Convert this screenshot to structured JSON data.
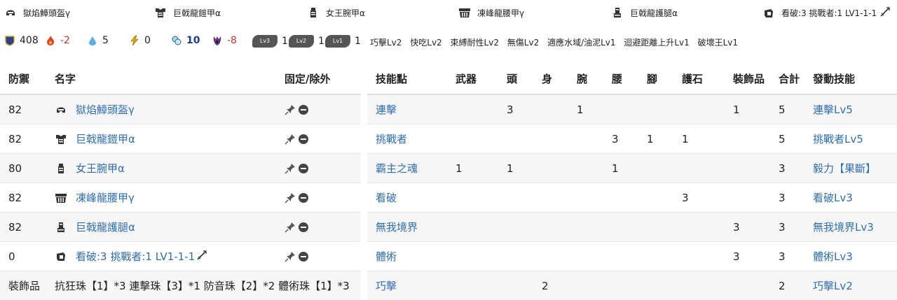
{
  "equipment_bar": [
    {
      "icon": "helm-icon",
      "name": "獄焰鱆頭盔γ"
    },
    {
      "icon": "chest-icon",
      "name": "巨戟龍鎧甲α"
    },
    {
      "icon": "arm-icon",
      "name": "女王腕甲α"
    },
    {
      "icon": "waist-icon",
      "name": "凍峰龍腰甲γ"
    },
    {
      "icon": "leg-icon",
      "name": "巨戟龍護腿α"
    },
    {
      "icon": "charm-icon",
      "name": "看破:3 挑戰者:1 LV1-1-1"
    }
  ],
  "stats": {
    "defense": "408",
    "fire": "-2",
    "water": "5",
    "thunder": "0",
    "ice": "10",
    "dragon": "-8",
    "slot_lv3_label": "Lv3",
    "slot_lv3_count": "1",
    "slot_lv2_label": "Lv2",
    "slot_lv2_count": "1",
    "slot_lv1_label": "Lv1",
    "slot_lv1_count": "1",
    "colors": {
      "fire": "#c0392b",
      "ice": "#1e3a8a",
      "link": "#2f6fb0"
    }
  },
  "skill_summary": [
    "巧擊Lv2",
    "快吃Lv2",
    "束縛耐性Lv2",
    "無傷Lv2",
    "適應水域/油泥Lv1",
    "迴避距離上升Lv1",
    "破壞王Lv1"
  ],
  "armor_table": {
    "headers": {
      "defense": "防禦",
      "name": "名字",
      "fix": "固定/除外"
    },
    "rows": [
      {
        "defense": "82",
        "icon": "helm-icon",
        "name": "獄焰鱆頭盔γ"
      },
      {
        "defense": "82",
        "icon": "chest-icon",
        "name": "巨戟龍鎧甲α"
      },
      {
        "defense": "80",
        "icon": "arm-icon",
        "name": "女王腕甲α"
      },
      {
        "defense": "82",
        "icon": "waist-icon",
        "name": "凍峰龍腰甲γ"
      },
      {
        "defense": "82",
        "icon": "leg-icon",
        "name": "巨戟龍護腿α"
      },
      {
        "defense": "0",
        "icon": "charm-icon",
        "name": "看破:3 挑戰者:1 LV1-1-1"
      }
    ],
    "decorations_label": "裝飾品",
    "decorations_value": "抗狂珠【1】*3 連擊珠【3】*1 防音珠【2】*2 體術珠【1】*3"
  },
  "skill_table": {
    "headers": {
      "skill": "技能點",
      "weapon": "武器",
      "head": "頭",
      "body": "身",
      "arm": "腕",
      "waist": "腰",
      "leg": "腳",
      "charm": "護石",
      "deco": "裝飾品",
      "total": "合計",
      "active": "發動技能"
    },
    "rows": [
      {
        "skill": "連擊",
        "weapon": "",
        "head": "3",
        "body": "",
        "arm": "1",
        "waist": "",
        "leg": "",
        "charm": "",
        "deco": "1",
        "total": "5",
        "active": "連擊Lv5"
      },
      {
        "skill": "挑戰者",
        "weapon": "",
        "head": "",
        "body": "",
        "arm": "",
        "waist": "3",
        "leg": "1",
        "charm": "1",
        "deco": "",
        "total": "5",
        "active": "挑戰者Lv5"
      },
      {
        "skill": "霸主之魂",
        "weapon": "1",
        "head": "1",
        "body": "",
        "arm": "",
        "waist": "1",
        "leg": "",
        "charm": "",
        "deco": "",
        "total": "3",
        "active": "毅力【果斷】"
      },
      {
        "skill": "看破",
        "weapon": "",
        "head": "",
        "body": "",
        "arm": "",
        "waist": "",
        "leg": "",
        "charm": "3",
        "deco": "",
        "total": "3",
        "active": "看破Lv3"
      },
      {
        "skill": "無我境界",
        "weapon": "",
        "head": "",
        "body": "",
        "arm": "",
        "waist": "",
        "leg": "",
        "charm": "",
        "deco": "3",
        "total": "3",
        "active": "無我境界Lv3"
      },
      {
        "skill": "體術",
        "weapon": "",
        "head": "",
        "body": "",
        "arm": "",
        "waist": "",
        "leg": "",
        "charm": "",
        "deco": "3",
        "total": "3",
        "active": "體術Lv3"
      },
      {
        "skill": "巧擊",
        "weapon": "",
        "head": "",
        "body": "2",
        "arm": "",
        "waist": "",
        "leg": "",
        "charm": "",
        "deco": "",
        "total": "2",
        "active": "巧擊Lv2"
      }
    ]
  }
}
